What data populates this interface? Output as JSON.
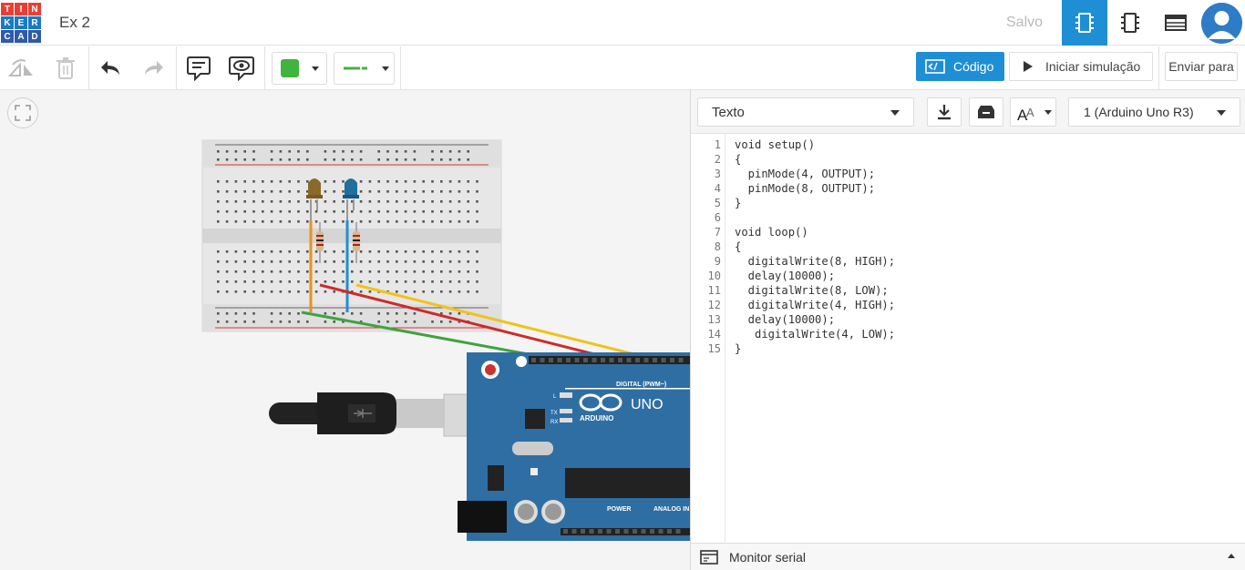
{
  "app": {
    "logo_letters": [
      "T",
      "I",
      "N",
      "K",
      "E",
      "R",
      "C",
      "A",
      "D"
    ],
    "logo_colors": [
      "#e93f33",
      "#e93f33",
      "#e93f33",
      "#1a7ac6",
      "#1a7ac6",
      "#1a7ac6",
      "#2e5aa8",
      "#2e5aa8",
      "#2e5aa8"
    ],
    "title": "Ex 2",
    "save_status": "Salvo",
    "accent": "#1e8fd5"
  },
  "toolbar": {
    "code_label": "Código",
    "simulate_label": "Iniciar simulação",
    "send_label": "Enviar para",
    "fill_color": "#3fb53f",
    "wire_color": "#3fb53f"
  },
  "code_panel": {
    "mode": "Texto",
    "device": "1 (Arduino Uno R3)",
    "lines": [
      "void setup()",
      "{",
      "  pinMode(4, OUTPUT);",
      "  pinMode(8, OUTPUT);",
      "}",
      "",
      "void loop()",
      "{",
      "  digitalWrite(8, HIGH);",
      "  delay(10000);",
      "  digitalWrite(8, LOW);",
      "  digitalWrite(4, HIGH);",
      "  delay(10000);",
      "   digitalWrite(4, LOW);",
      "}"
    ],
    "serial_label": "Monitor serial"
  },
  "board": {
    "digital_label": "DIGITAL (PWM~)",
    "brand": "ARDUINO",
    "model": "UNO",
    "power_label": "POWER",
    "analog_label": "ANALOG IN",
    "pin_tx": "TX",
    "pin_rx": "RX",
    "pin_l": "L"
  }
}
